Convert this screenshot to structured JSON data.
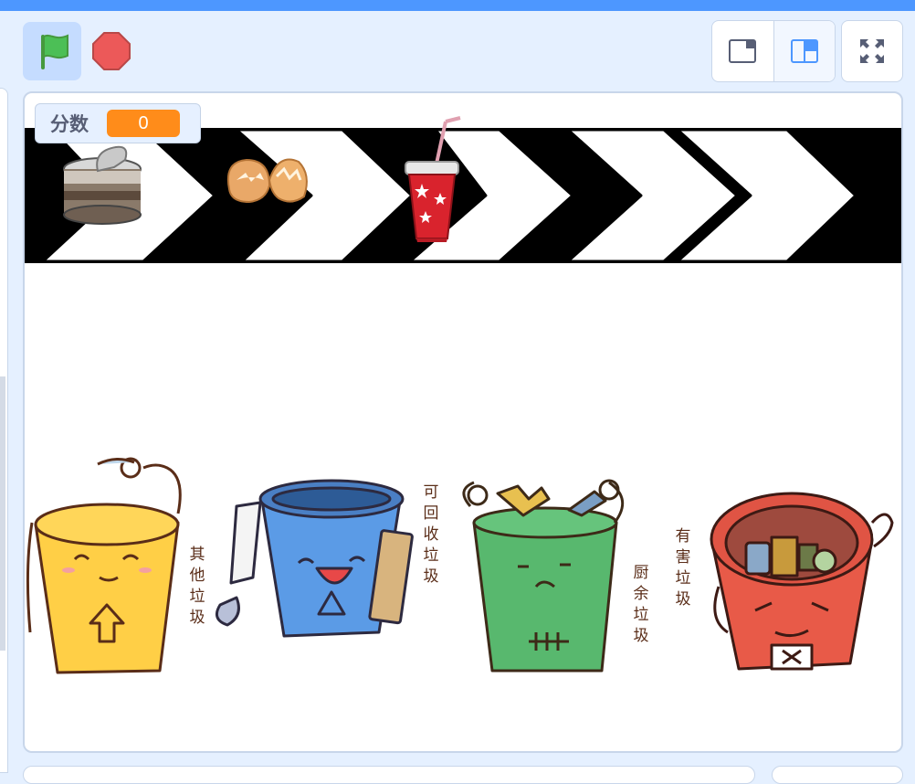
{
  "controls": {
    "green_flag": "green-flag-icon",
    "stop": "stop-sign-icon",
    "small_stage": "small-stage-icon",
    "normal_stage": "normal-stage-icon",
    "fullscreen": "fullscreen-icon"
  },
  "monitor": {
    "label": "分数",
    "value": "0"
  },
  "bins": {
    "other": "其他垃圾",
    "recyclable": "可回收垃圾",
    "kitchen": "厨余垃圾",
    "hazardous": "有害垃圾"
  },
  "items": [
    "tin-can-sprite",
    "egg-shell-sprite",
    "soda-cup-sprite"
  ],
  "colors": {
    "accent": "#4d97ff",
    "monitor_value": "#ff8c1a",
    "bin_other": "#ffcf46",
    "bin_recyclable": "#5b9be6",
    "bin_kitchen": "#58b86e",
    "bin_hazardous": "#e85a48"
  }
}
